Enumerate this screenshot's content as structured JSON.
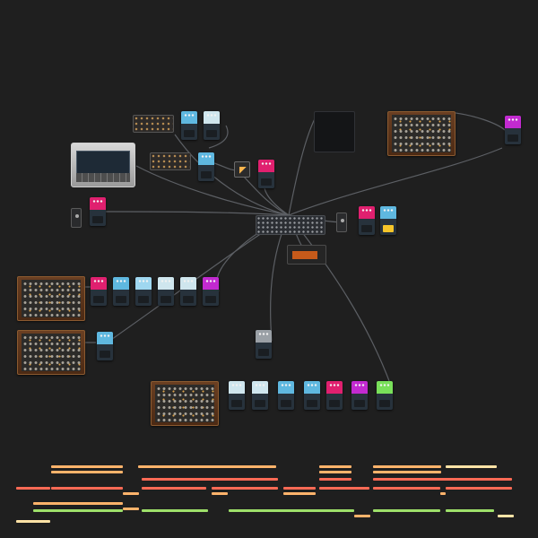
{
  "workspace": {
    "background": "#1f1f1f",
    "cable_color": "#5c5f64"
  },
  "devices": [
    {
      "id": "synth-top-right",
      "kind": "synth"
    },
    {
      "id": "synth-left-1",
      "kind": "synth"
    },
    {
      "id": "synth-left-2",
      "kind": "synth"
    },
    {
      "id": "synth-bottom",
      "kind": "synth"
    },
    {
      "id": "silver-synth",
      "kind": "silver"
    },
    {
      "id": "mixer-main",
      "kind": "mixer"
    },
    {
      "id": "box-top",
      "kind": "small-box"
    },
    {
      "id": "box-mid",
      "kind": "small-box"
    },
    {
      "id": "black-box",
      "kind": "dark-box"
    },
    {
      "id": "display-box",
      "kind": "display-box"
    },
    {
      "id": "orange-box",
      "kind": "orange-box"
    },
    {
      "id": "tiny-left",
      "kind": "tiny"
    },
    {
      "id": "tiny-right",
      "kind": "tiny"
    }
  ],
  "pedal_colors": {
    "blue": "#5fb8e0",
    "lightblue": "#9fd7f0",
    "pale": "#cfe6ee",
    "pink": "#e0206f",
    "magenta": "#c22ad0",
    "yellow": "#f5c52a",
    "green": "#79e05a",
    "gray": "#9aa0a6"
  },
  "pedals": [
    {
      "id": "p1",
      "color": "blue"
    },
    {
      "id": "p2",
      "color": "pale"
    },
    {
      "id": "p3",
      "color": "blue"
    },
    {
      "id": "p4",
      "color": "pink"
    },
    {
      "id": "p5",
      "color": "pink"
    },
    {
      "id": "p6",
      "color": "magenta"
    },
    {
      "id": "p7",
      "color": "pink"
    },
    {
      "id": "p8",
      "color": "blue"
    },
    {
      "id": "p9",
      "color": "yellow"
    },
    {
      "id": "p10",
      "color": "pink"
    },
    {
      "id": "p11",
      "color": "blue"
    },
    {
      "id": "p12",
      "color": "lightblue"
    },
    {
      "id": "p13",
      "color": "pale"
    },
    {
      "id": "p14",
      "color": "pale"
    },
    {
      "id": "p15",
      "color": "magenta"
    },
    {
      "id": "p16",
      "color": "blue"
    },
    {
      "id": "p17",
      "color": "gray"
    },
    {
      "id": "p18",
      "color": "pale"
    },
    {
      "id": "p19",
      "color": "pale"
    },
    {
      "id": "p20",
      "color": "blue"
    },
    {
      "id": "p21",
      "color": "blue"
    },
    {
      "id": "p22",
      "color": "pink"
    },
    {
      "id": "p23",
      "color": "magenta"
    },
    {
      "id": "p24",
      "color": "green"
    }
  ],
  "timeline": {
    "colors": {
      "orange": "#ffb36b",
      "red": "#ff6a55",
      "green": "#9ee06a",
      "cream": "#ffe3a6"
    }
  }
}
